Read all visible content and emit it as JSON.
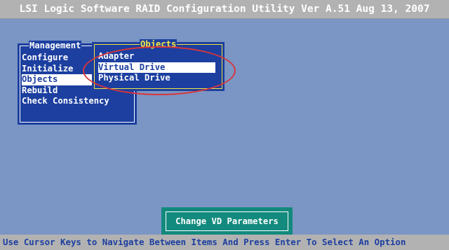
{
  "app": {
    "title": "LSI Logic Software RAID Configuration Utility Ver A.51 Aug 13, 2007"
  },
  "management_menu": {
    "title": "Management",
    "items": [
      {
        "label": "Configure",
        "selected": false
      },
      {
        "label": "Initialize",
        "selected": false
      },
      {
        "label": "Objects",
        "selected": true
      },
      {
        "label": "Rebuild",
        "selected": false
      },
      {
        "label": "Check Consistency",
        "selected": false
      }
    ]
  },
  "objects_menu": {
    "title": "Objects",
    "items": [
      {
        "label": "Adapter",
        "selected": false
      },
      {
        "label": "Virtual Drive",
        "selected": true
      },
      {
        "label": "Physical Drive",
        "selected": false
      }
    ]
  },
  "popup": {
    "label": "Change VD Parameters"
  },
  "status_bar": {
    "text": "Use Cursor Keys to Navigate Between Items And Press Enter To Select An Option"
  },
  "colors": {
    "background": "#7b96c4",
    "menu_bg": "#1c3fa0",
    "bar_bg": "#b2b2b2",
    "objects_frame": "#f2e640",
    "popup_bg": "#138a7e",
    "highlight_ellipse": "#d9353a"
  }
}
